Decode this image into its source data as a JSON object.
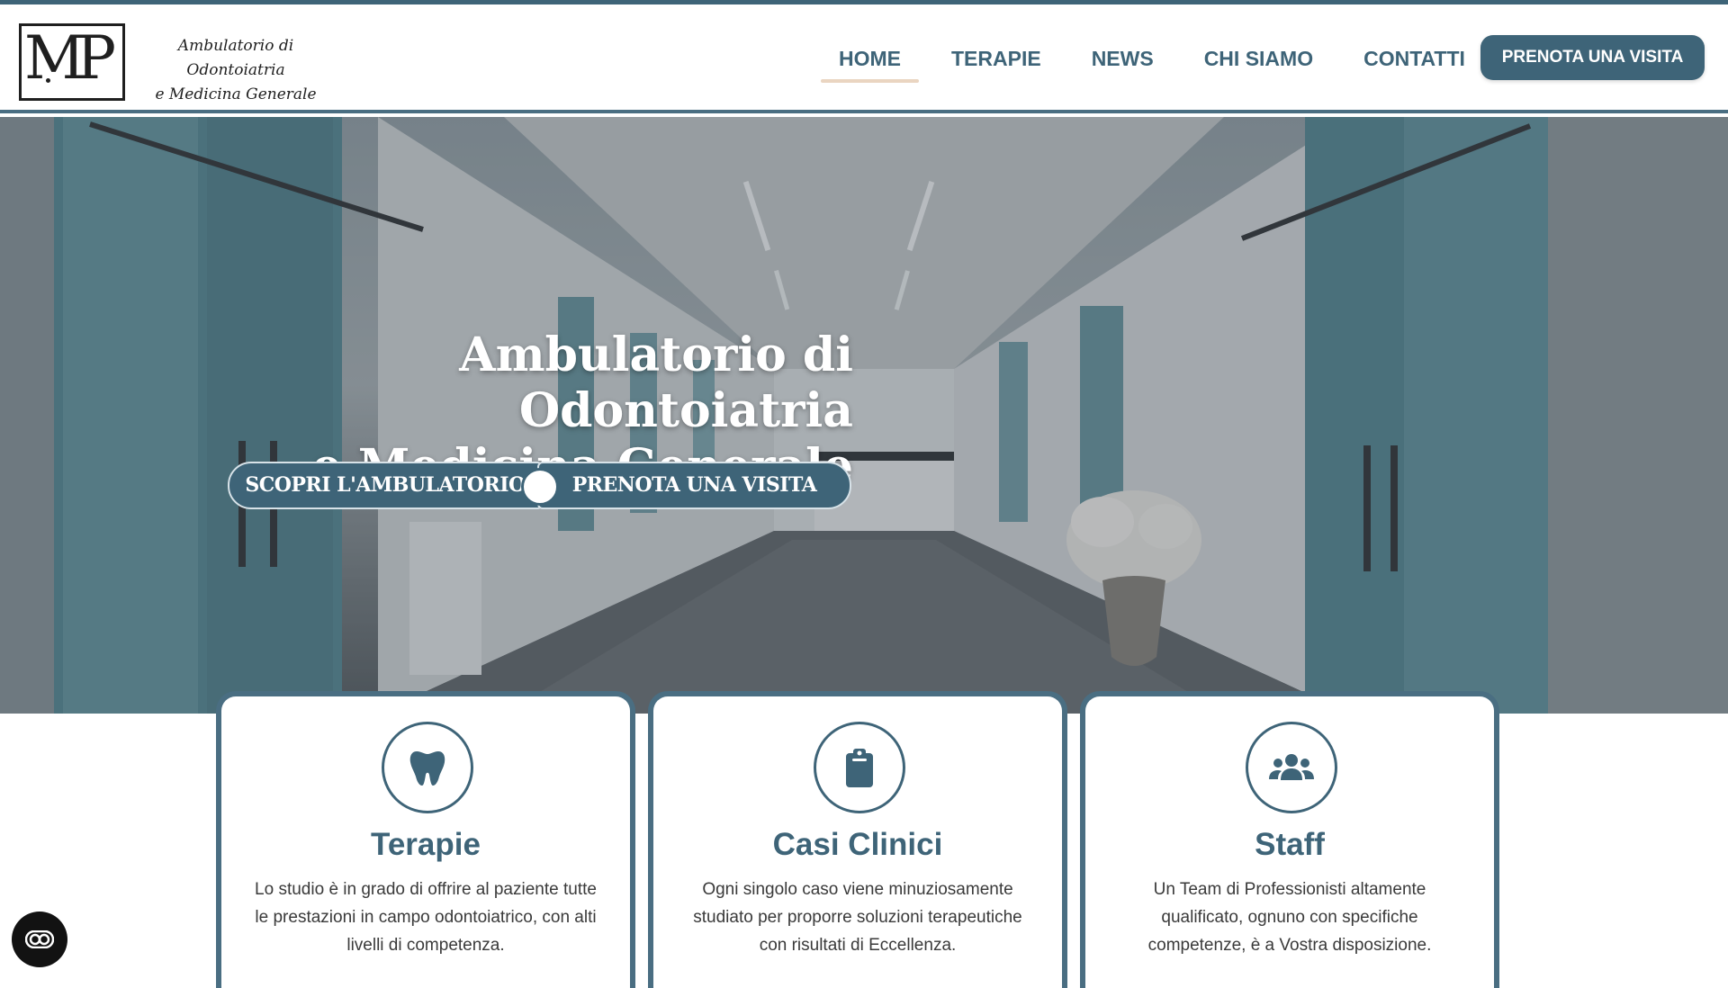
{
  "header": {
    "logo_line1": "Ambulatorio di Odontoiatria",
    "logo_line2": "e Medicina Generale",
    "logo_monogram": "MP",
    "nav": [
      {
        "label": "HOME",
        "active": true
      },
      {
        "label": "TERAPIE",
        "active": false
      },
      {
        "label": "NEWS",
        "active": false
      },
      {
        "label": "CHI SIAMO",
        "active": false
      },
      {
        "label": "CONTATTI",
        "active": false
      }
    ],
    "cta_label": "PRENOTA UNA VISITA"
  },
  "hero": {
    "title_line1": "Ambulatorio di Odontoiatria",
    "title_line2": "e Medicina Generale",
    "btn_discover": "SCOPRI L'AMBULATORIO",
    "btn_book": "PRENOTA UNA VISITA"
  },
  "cards": [
    {
      "icon": "tooth-icon",
      "title": "Terapie",
      "text": "Lo studio è in grado di offrire al paziente tutte le prestazioni in campo odontoiatrico, con alti livelli di competenza."
    },
    {
      "icon": "clipboard-icon",
      "title": "Casi Clinici",
      "text": "Ogni singolo caso viene minuziosamente studiato per proporre soluzioni terapeutiche con risultati di Eccellenza."
    },
    {
      "icon": "group-icon",
      "title": "Staff",
      "text": "Un Team di Professionisti altamente qualificato, ognuno con specifiche competenze, è a Vostra disposizione."
    }
  ],
  "accessibility": {
    "icon": "accessibility-toggle-icon"
  },
  "colors": {
    "primary": "#3e6478",
    "accent_underline": "#ead5c1",
    "text": "#3a3a3a"
  }
}
